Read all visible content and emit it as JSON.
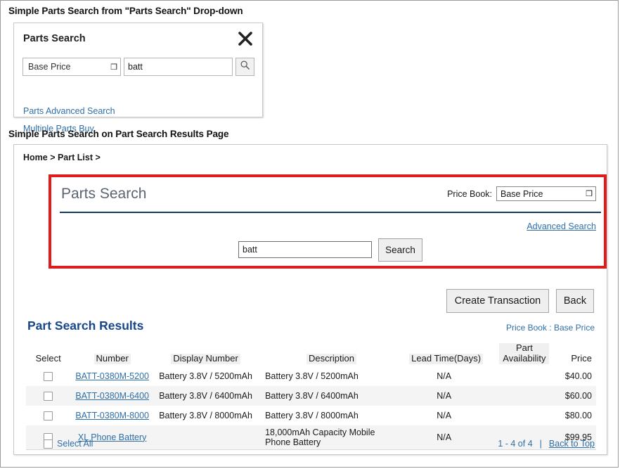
{
  "captions": {
    "first": "Simple Parts Search from \"Parts Search\" Drop-down",
    "second": "Simple Parts Search on Part Search Results Page"
  },
  "dropdown_panel": {
    "title": "Parts Search",
    "close_icon": "close-x-icon",
    "price_book_value": "Base Price",
    "search_value": "batt",
    "search_icon": "magnifier-icon",
    "links": [
      "Parts Advanced Search",
      "Multiple Parts Buy"
    ]
  },
  "results_page": {
    "breadcrumb": "Home > Part List >",
    "search_panel": {
      "title": "Parts Search",
      "price_book_label": "Price Book:",
      "price_book_value": "Base Price",
      "advanced_search_link": "Advanced Search",
      "search_value": "batt",
      "search_button": "Search"
    },
    "actions": {
      "create_transaction": "Create Transaction",
      "back": "Back"
    },
    "price_book_note": "Price Book : Base Price",
    "results_heading": "Part Search Results",
    "table": {
      "headers": [
        "Select",
        "Number",
        "Display Number",
        "Description",
        "Lead Time(Days)",
        "Part Availability",
        "Price"
      ],
      "rows": [
        {
          "number": "BATT-0380M-5200",
          "display_number": "Battery 3.8V / 5200mAh",
          "description": "Battery 3.8V / 5200mAh",
          "lead_time": "N/A",
          "availability": "",
          "price": "$40.00"
        },
        {
          "number": "BATT-0380M-6400",
          "display_number": "Battery 3.8V / 6400mAh",
          "description": "Battery 3.8V / 6400mAh",
          "lead_time": "N/A",
          "availability": "",
          "price": "$60.00"
        },
        {
          "number": "BATT-0380M-8000",
          "display_number": "Battery 3.8V / 8000mAh",
          "description": "Battery 3.8V / 8000mAh",
          "lead_time": "N/A",
          "availability": "",
          "price": "$80.00"
        },
        {
          "number": "XL Phone Battery",
          "display_number": "",
          "description": "18,000mAh Capacity Mobile Phone Battery",
          "lead_time": "N/A",
          "availability": "",
          "price": "$99.95"
        }
      ]
    },
    "footer": {
      "select_all": "Select All",
      "pagination": "1 - 4 of 4",
      "divider": "|",
      "back_to_top": "Back to Top"
    }
  },
  "colors": {
    "highlight_red": "#e01b1b",
    "link_blue": "#2f6fa8",
    "heading_navy": "#17468a",
    "rule_navy": "#133a63"
  }
}
